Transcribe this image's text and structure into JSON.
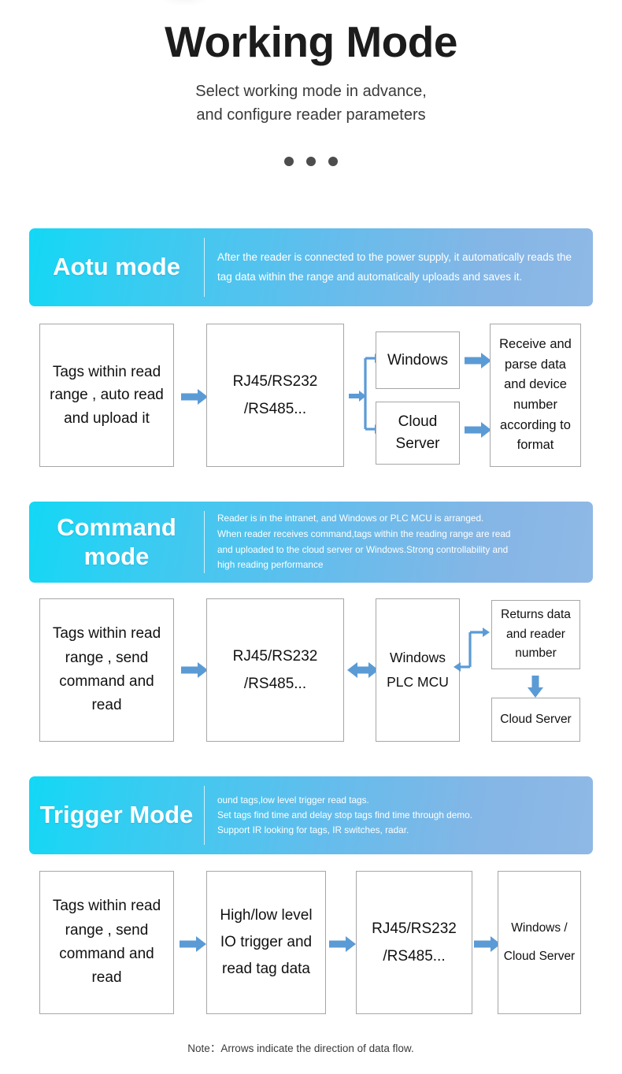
{
  "hero": {
    "title": "Working Mode",
    "subtitle_line1": "Select working mode in advance,",
    "subtitle_line2": "and configure reader parameters"
  },
  "colors": {
    "gradient_start": "#12d8f5",
    "gradient_end": "#8fb8e6",
    "arrow_blue": "#5b9bd5",
    "box_border": "#a6a6a6",
    "text_dark": "#111111",
    "dot_gray": "#4d4d4d"
  },
  "modes": [
    {
      "name": "Aotu mode",
      "description": "After the reader is connected to the power supply, it automatically reads the tag data within the range and automatically uploads and saves it.",
      "nodes": {
        "source": "Tags within read range , auto read and upload it",
        "interface": "RJ45/RS232 /RS485...",
        "branch_top": "Windows",
        "branch_bottom": "Cloud Server",
        "sink": "Receive and parse data and device number according to format"
      }
    },
    {
      "name": "Command mode",
      "description_lines": [
        "Reader is in the intranet, and Windows or PLC MCU is arranged.",
        "When reader receives command,tags within the reading range are read",
        "and uploaded to the cloud server or Windows.Strong controllability and",
        "high reading performance"
      ],
      "nodes": {
        "source": "Tags within read range , send command and read",
        "interface": "RJ45/RS232 /RS485...",
        "host": "Windows PLC MCU",
        "returns": "Returns data and reader number",
        "cloud": "Cloud Server"
      }
    },
    {
      "name": "Trigger Mode",
      "description_lines": [
        "ound tags,low level trigger read tags.",
        "Set tags find time and delay stop tags find time through demo.",
        "Support IR looking for tags, IR switches, radar."
      ],
      "nodes": {
        "source": "Tags within read range , send command and read",
        "trigger": "High/low level IO trigger and read tag data",
        "interface": "RJ45/RS232 /RS485...",
        "sink": "Windows / Cloud Server"
      }
    }
  ],
  "footer": {
    "note": "Note：Arrows indicate the direction of data flow."
  }
}
